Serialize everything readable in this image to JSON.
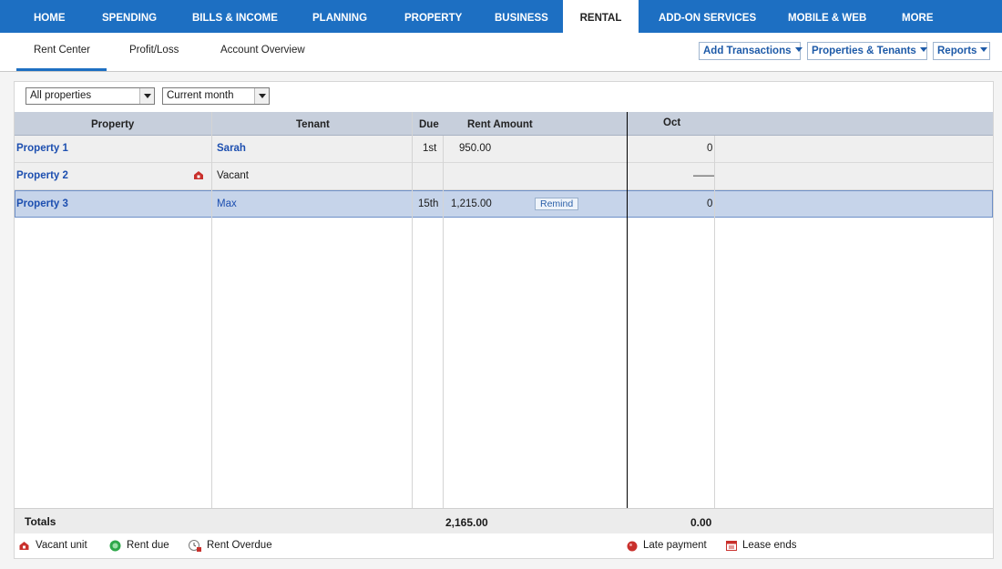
{
  "topnav": {
    "tabs": [
      {
        "label": "HOME"
      },
      {
        "label": "SPENDING"
      },
      {
        "label": "BILLS & INCOME"
      },
      {
        "label": "PLANNING"
      },
      {
        "label": "PROPERTY"
      },
      {
        "label": "BUSINESS"
      },
      {
        "label": "RENTAL"
      },
      {
        "label": "ADD-ON SERVICES"
      },
      {
        "label": "MOBILE & WEB"
      },
      {
        "label": "MORE"
      }
    ],
    "active": "RENTAL"
  },
  "subnav": {
    "tabs": [
      {
        "label": "Rent Center"
      },
      {
        "label": "Profit/Loss"
      },
      {
        "label": "Account Overview"
      }
    ],
    "buttons": {
      "add_transactions": "Add Transactions",
      "properties_tenants": "Properties & Tenants",
      "reports": "Reports"
    }
  },
  "filters": {
    "property": "All properties",
    "period": "Current month"
  },
  "table": {
    "headers": {
      "property": "Property",
      "tenant": "Tenant",
      "due": "Due",
      "rent_amount": "Rent Amount",
      "month": "Oct"
    },
    "rows": [
      {
        "property": "Property 1",
        "tenant": "Sarah",
        "due": "1st",
        "rent": "950.00",
        "month_value": "0"
      },
      {
        "property": "Property 2",
        "tenant": "Vacant",
        "due": "",
        "rent": "",
        "month_value": "——"
      },
      {
        "property": "Property 3",
        "tenant": "Max",
        "due": "15th",
        "rent": "1,215.00",
        "action": "Remind",
        "month_value": "0"
      }
    ],
    "totals": {
      "label": "Totals",
      "rent": "2,165.00",
      "month": "0.00"
    }
  },
  "legend": {
    "vacant": "Vacant unit",
    "rent_due": "Rent due",
    "rent_overdue": "Rent Overdue",
    "late_payment": "Late payment",
    "lease_ends": "Lease ends"
  },
  "colors": {
    "nav_blue": "#1d6fc2",
    "link_blue": "#1d4fb0",
    "vacant_red": "#c9302c",
    "rent_due_green": "#2ea84a"
  }
}
